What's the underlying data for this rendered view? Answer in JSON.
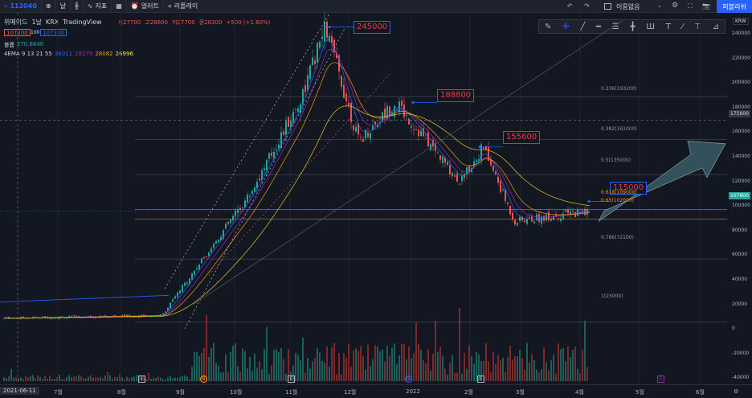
{
  "topbar": {
    "symbol": "112040",
    "interval": "날",
    "indicators_label": "지표",
    "alert_label": "얼러트",
    "replay_label": "리플레이",
    "layout_name": "이름없음",
    "publish_label": "퍼블리쉬"
  },
  "header": {
    "name": "위메이드",
    "interval": "1날",
    "exchange": "KRX",
    "source": "TradingView",
    "ohlc_open": "시27700",
    "ohlc_high": "고28600",
    "ohlc_low": "저27700",
    "ohlc_close": "종28300",
    "ohlc_change": "+500 (+1.80%)",
    "bid_price": "107200",
    "lot": "100",
    "ask_price": "107300"
  },
  "indicators": {
    "volume_label": "볼륨",
    "volume_value": "270.864K",
    "ema_label": "4EMA 9 13 21 55",
    "ema_values": [
      "38011",
      "28279",
      "28082",
      "26996"
    ]
  },
  "drawing_tools": [
    "pen-tool",
    "cross-tool",
    "line-tool",
    "horizontal-line-tool",
    "channel-tool",
    "measure-tool",
    "fork-tool",
    "text-tool",
    "brush-tool",
    "label-tool",
    "ruler-tool"
  ],
  "callouts": [
    "245000",
    "188800",
    "155600",
    "115000"
  ],
  "fib_levels": [
    "0.236(193200)",
    "0.382(161000)",
    "0.5(135000)",
    "0.618(109000)",
    "0.65(102000)",
    "0.786(72100)",
    "1(25000)"
  ],
  "y_axis": {
    "currency_label": "KRW",
    "ticks": [
      "240000",
      "220000",
      "200000",
      "180000",
      "160000",
      "140000",
      "120000",
      "100000",
      "80000",
      "60000",
      "40000",
      "20000",
      "0",
      "-20000",
      "-40000"
    ],
    "crosshair_price": "175600",
    "current_price": "107800"
  },
  "x_axis": {
    "date_label": "2021-06-11",
    "ticks": [
      "7월",
      "8월",
      "9월",
      "10월",
      "11월",
      "12월",
      "2022",
      "2월",
      "3월",
      "4월",
      "5월",
      "6월"
    ]
  },
  "events": [
    "E",
    "S",
    "E",
    "D",
    "E",
    "E"
  ],
  "colors": {
    "up": "#26a69a",
    "down": "#ef5350",
    "accent": "#2962ff",
    "background": "#131722"
  },
  "chart_data": {
    "type": "line",
    "title": "위메이드 · 1날 · KRX",
    "price_path_approx": [
      {
        "x": "2021-06-11",
        "y": 28000
      },
      {
        "x": "2021-08-31",
        "y": 30000
      },
      {
        "x": "2021-09-15",
        "y": 60000
      },
      {
        "x": "2021-10-15",
        "y": 120000
      },
      {
        "x": "2021-11-10",
        "y": 190000
      },
      {
        "x": "2021-11-23",
        "y": 245000
      },
      {
        "x": "2021-12-10",
        "y": 160000
      },
      {
        "x": "2021-12-29",
        "y": 188800
      },
      {
        "x": "2022-01-31",
        "y": 130000
      },
      {
        "x": "2022-02-12",
        "y": 155600
      },
      {
        "x": "2022-02-28",
        "y": 100000
      },
      {
        "x": "2022-04-06",
        "y": 107800
      }
    ],
    "ylim": [
      -40000,
      250000
    ]
  }
}
